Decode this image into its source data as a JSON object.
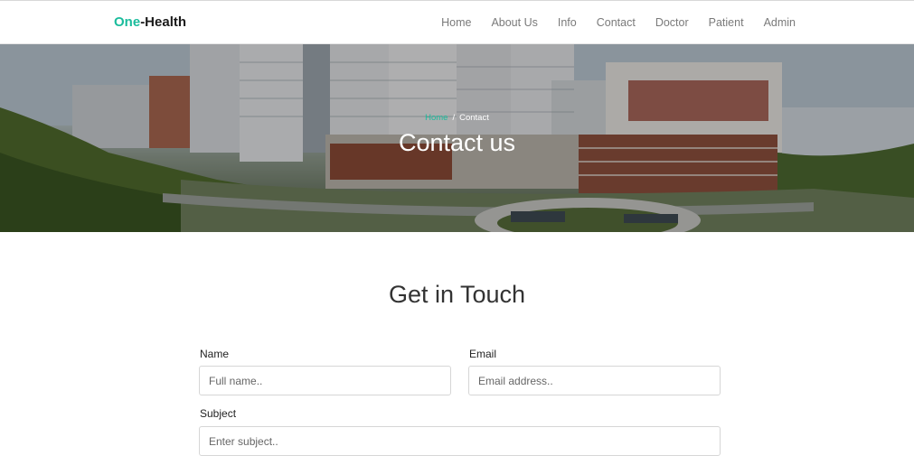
{
  "brand": {
    "accent": "One",
    "rest": "-Health"
  },
  "nav": {
    "items": [
      "Home",
      "About Us",
      "Info",
      "Contact",
      "Doctor",
      "Patient",
      "Admin"
    ]
  },
  "hero": {
    "breadcrumb": {
      "home": "Home",
      "separator": "/",
      "current": "Contact"
    },
    "title": "Contact us"
  },
  "contact": {
    "heading": "Get in Touch",
    "name": {
      "label": "Name",
      "placeholder": "Full name.."
    },
    "email": {
      "label": "Email",
      "placeholder": "Email address.."
    },
    "subject": {
      "label": "Subject",
      "placeholder": "Enter subject.."
    }
  },
  "colors": {
    "accent": "#1abc9c"
  }
}
